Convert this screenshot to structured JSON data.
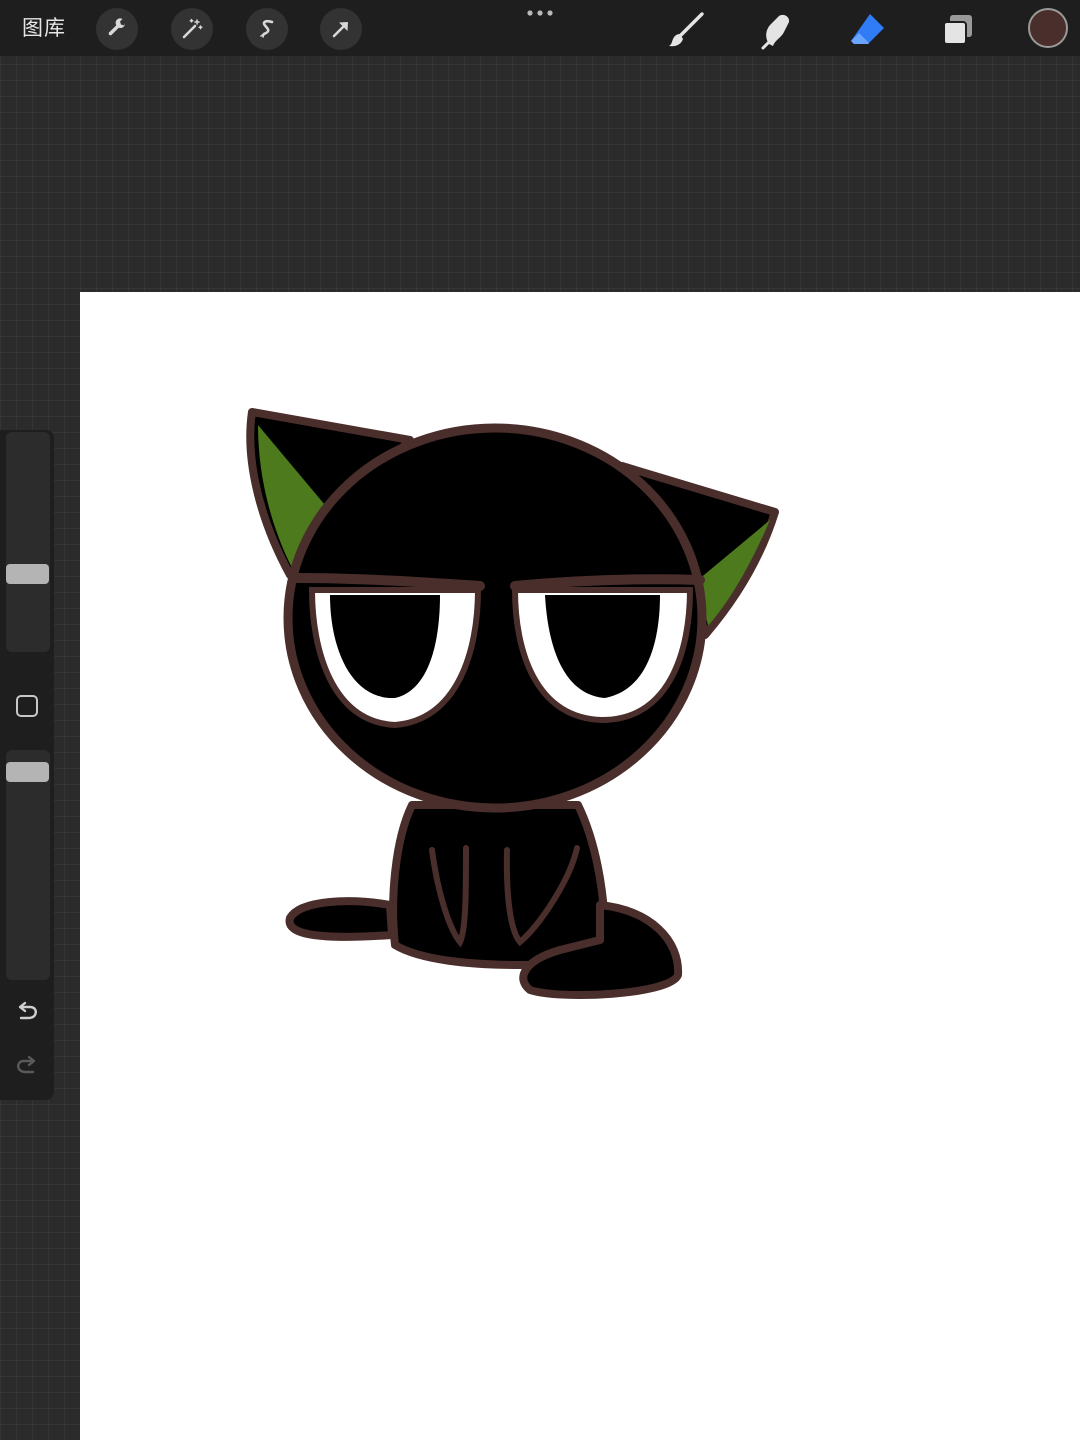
{
  "topbar": {
    "gallery_label": "图库",
    "left_tools": [
      "wrench-icon",
      "magic-wand-icon",
      "selection-s-icon",
      "transform-arrow-icon"
    ],
    "right_tools": [
      "brush-icon",
      "smudge-icon",
      "eraser-icon",
      "layers-icon"
    ],
    "active_tool": "eraser-icon",
    "active_color": "#4a2e2b",
    "accent": "#2f7cf6"
  },
  "sidebar": {
    "brush_size_level": 0.53,
    "opacity_level": 0.0,
    "modify_icon": "square-icon",
    "undo_icon": "undo-icon",
    "redo_icon": "redo-icon",
    "redo_enabled": false
  },
  "artwork": {
    "subject": "cat-drawing-icon",
    "outline_color": "#4a2e2b",
    "body_color": "#000000",
    "ear_color": "#4c7a1c",
    "eye_white": "#ffffff"
  }
}
